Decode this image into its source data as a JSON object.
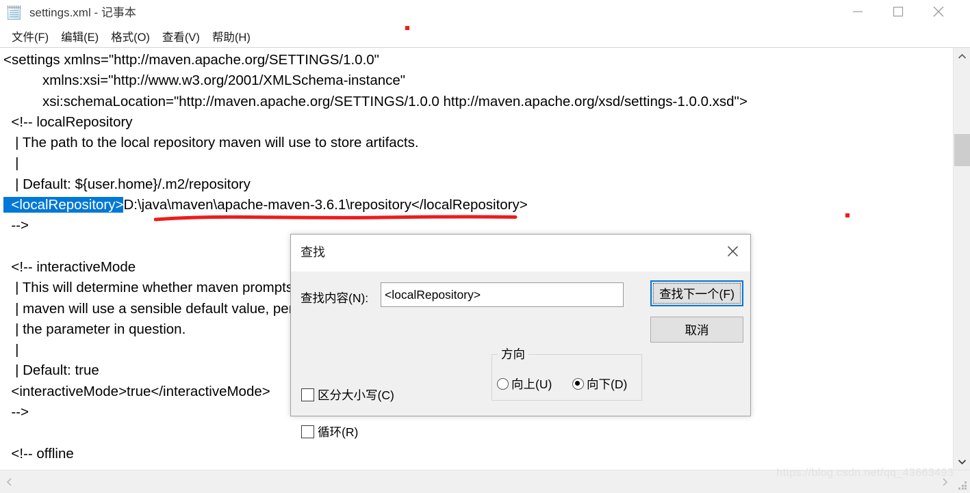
{
  "window": {
    "title": "settings.xml - 记事本",
    "icon": "notepad-icon",
    "minimize_label": "最小化",
    "maximize_label": "最大化",
    "close_label": "关闭"
  },
  "menu": {
    "items": [
      {
        "label": "文件(F)"
      },
      {
        "label": "编辑(E)"
      },
      {
        "label": "格式(O)"
      },
      {
        "label": "查看(V)"
      },
      {
        "label": "帮助(H)"
      }
    ]
  },
  "editor": {
    "lines": [
      {
        "text": "<settings xmlns=\"http://maven.apache.org/SETTINGS/1.0.0\""
      },
      {
        "text": "          xmlns:xsi=\"http://www.w3.org/2001/XMLSchema-instance\""
      },
      {
        "text": "          xsi:schemaLocation=\"http://maven.apache.org/SETTINGS/1.0.0 http://maven.apache.org/xsd/settings-1.0.0.xsd\">"
      },
      {
        "text": "  <!-- localRepository"
      },
      {
        "text": "   | The path to the local repository maven will use to store artifacts."
      },
      {
        "text": "   |"
      },
      {
        "text": "   | Default: ${user.home}/.m2/repository"
      },
      {
        "selected": "  <localRepository>",
        "text": "D:\\java\\maven\\apache-maven-3.6.1\\repository</localRepository>"
      },
      {
        "text": "  -->"
      },
      {
        "text": ""
      },
      {
        "text": "  <!-- interactiveMode"
      },
      {
        "text": "   | This will determine whether maven prompts you when it needs input. If set to false,"
      },
      {
        "text": "   | maven will use a sensible default value, perhaps based on some other setting, for"
      },
      {
        "text": "   | the parameter in question."
      },
      {
        "text": "   |"
      },
      {
        "text": "   | Default: true"
      },
      {
        "text": "  <interactiveMode>true</interactiveMode>"
      },
      {
        "text": "  -->"
      },
      {
        "text": ""
      },
      {
        "text": "  <!-- offline"
      }
    ]
  },
  "find_dialog": {
    "title": "查找",
    "close_label": "关闭",
    "find_what_label": "查找内容(N):",
    "find_what_value": "<localRepository>",
    "find_what_placeholder": "",
    "direction_legend": "方向",
    "radio_up_label": "向上(U)",
    "radio_down_label": "向下(D)",
    "direction_selected": "down",
    "match_case_label": "区分大小写(C)",
    "match_case_checked": false,
    "wrap_around_label": "循环(R)",
    "wrap_around_checked": false,
    "find_next_label": "查找下一个(F)",
    "cancel_label": "取消",
    "focus_color": "#0078d7"
  },
  "annotations": {
    "underline_color": "#ee1c1c",
    "dot_color": "#f41a12",
    "underline_note": "red hand-drawn underline under the localRepository path",
    "dots": 2
  },
  "watermark": {
    "text": "https://blog.csdn.net/qq_43663493"
  },
  "scrollbars": {
    "vertical_position": "near-top",
    "horizontal_position": "left"
  }
}
